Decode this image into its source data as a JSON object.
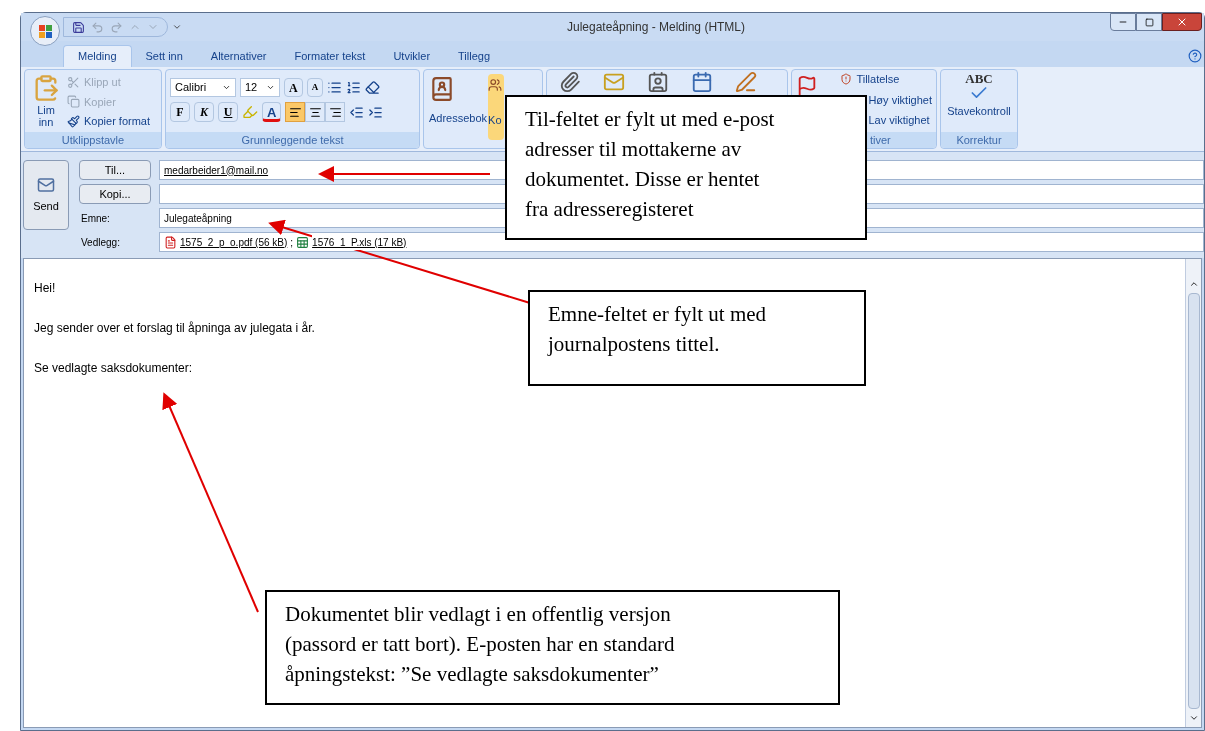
{
  "window": {
    "title": "Julegateåpning - Melding (HTML)"
  },
  "tabs": [
    {
      "label": "Melding",
      "selected": true
    },
    {
      "label": "Sett inn",
      "selected": false
    },
    {
      "label": "Alternativer",
      "selected": false
    },
    {
      "label": "Formater tekst",
      "selected": false
    },
    {
      "label": "Utvikler",
      "selected": false
    },
    {
      "label": "Tillegg",
      "selected": false
    }
  ],
  "ribbon": [
    {
      "kind": "clipboard",
      "label": "Utklippstavle",
      "paste": "Lim inn",
      "items": [
        {
          "label": "Klipp ut",
          "disabled": true
        },
        {
          "label": "Kopier",
          "disabled": true
        },
        {
          "label": "Kopier format",
          "disabled": false
        }
      ]
    },
    {
      "kind": "font",
      "label": "Grunnleggende tekst",
      "font": "Calibri",
      "size": "12",
      "grow": "A",
      "shrink": "A",
      "bold": "F",
      "italic": "K",
      "underline": "U",
      "font_color_letter": "A",
      "align": [
        {
          "selected": true
        },
        {
          "selected": false
        },
        {
          "selected": false
        }
      ]
    },
    {
      "kind": "names",
      "buttons": [
        {
          "label": "Adressebok",
          "selected": false
        },
        {
          "label": "Ko",
          "selected": true
        }
      ]
    },
    {
      "kind": "include"
    },
    {
      "kind": "options",
      "label": "tiver",
      "items": [
        "Tillatelse",
        "Høy viktighet",
        "Lav viktighet"
      ]
    },
    {
      "kind": "proofing",
      "label": "Korrektur",
      "mark": "ABC",
      "button": "Stavekontroll"
    }
  ],
  "header": {
    "send": "Send",
    "to": {
      "button": "Til...",
      "value": "medarbeider1@mail.no"
    },
    "cc": {
      "button": "Kopi..."
    },
    "subject": {
      "label": "Emne:",
      "value": "Julegateåpning"
    },
    "attachments": {
      "label": "Vedlegg:",
      "files": [
        {
          "kind": "pdf",
          "name": "1575_2_p_o.pdf (56 kB)"
        },
        {
          "kind": "xls",
          "name": "1576_1_P.xls (17 kB)"
        }
      ],
      "separator": ";"
    }
  },
  "body": [
    "Hei!",
    "Jeg sender over et forslag til åpninga av julegata i år.",
    "Se vedlagte saksdokumenter:"
  ],
  "callouts": [
    {
      "lines": [
        "Til-feltet er fylt ut med e-post",
        "adresser til mottakerne av",
        "dokumentet. Disse er hentet",
        "fra adresseregisteret"
      ]
    },
    {
      "lines": [
        "Emne-feltet er fylt ut med",
        "journalpostens tittel."
      ]
    },
    {
      "lines": [
        "Dokumentet blir vedlagt i en offentlig versjon",
        "(passord er tatt bort). E-posten har en standard",
        "åpningstekst: ”Se vedlagte saksdokumenter”"
      ]
    }
  ]
}
